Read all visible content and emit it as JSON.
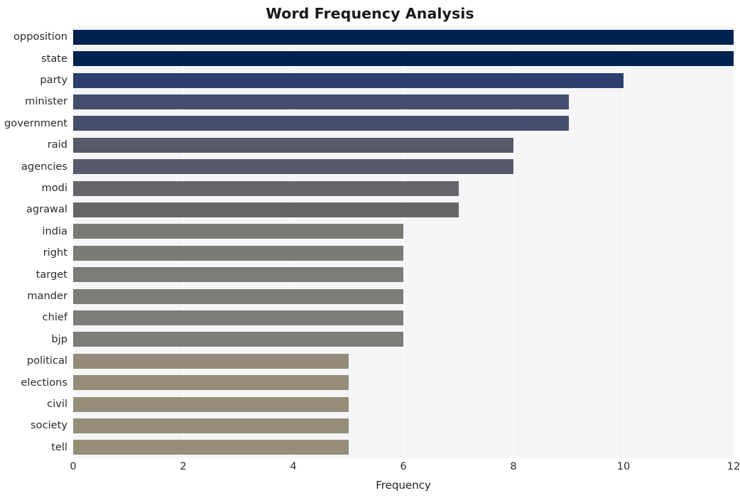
{
  "chart_data": {
    "type": "bar",
    "orientation": "horizontal",
    "title": "Word Frequency Analysis",
    "xlabel": "Frequency",
    "ylabel": "",
    "xlim": [
      0,
      12
    ],
    "ylim": [
      0,
      20
    ],
    "xticks": [
      0,
      2,
      4,
      6,
      8,
      10,
      12
    ],
    "xtick_labels": [
      "0",
      "2",
      "4",
      "6",
      "8",
      "10",
      "12"
    ],
    "grid": true,
    "grid_axis": "x",
    "grid_color": "#ffffff",
    "plot_background": "#f5f5f7",
    "figure_background": "#ffffff",
    "legend": null,
    "categories": [
      "opposition",
      "state",
      "party",
      "minister",
      "government",
      "raid",
      "agencies",
      "modi",
      "agrawal",
      "india",
      "right",
      "target",
      "mander",
      "chief",
      "bjp",
      "political",
      "elections",
      "civil",
      "society",
      "tell"
    ],
    "values": [
      12,
      12,
      10,
      9,
      9,
      8,
      8,
      7,
      7,
      6,
      6,
      6,
      6,
      6,
      6,
      5,
      5,
      5,
      5,
      5
    ],
    "bar_colors": [
      "#00234f",
      "#00234f",
      "#2c3f6e",
      "#434d6d",
      "#454e6c",
      "#565a69",
      "#565a6a",
      "#656669",
      "#666669",
      "#7a7974",
      "#7b7a75",
      "#7c7b77",
      "#7c7b77",
      "#7d7c78",
      "#7d7c78",
      "#948c79",
      "#958d78",
      "#968e78",
      "#968e78",
      "#968d77"
    ],
    "colormap": "cividis-reversed",
    "bars": [
      {
        "label": "opposition",
        "value": 12,
        "color": "#00234f"
      },
      {
        "label": "state",
        "value": 12,
        "color": "#00234f"
      },
      {
        "label": "party",
        "value": 10,
        "color": "#2c3f6e"
      },
      {
        "label": "minister",
        "value": 9,
        "color": "#434d6d"
      },
      {
        "label": "government",
        "value": 9,
        "color": "#454e6c"
      },
      {
        "label": "raid",
        "value": 8,
        "color": "#565a69"
      },
      {
        "label": "agencies",
        "value": 8,
        "color": "#565a6a"
      },
      {
        "label": "modi",
        "value": 7,
        "color": "#656669"
      },
      {
        "label": "agrawal",
        "value": 7,
        "color": "#666669"
      },
      {
        "label": "india",
        "value": 6,
        "color": "#7a7974"
      },
      {
        "label": "right",
        "value": 6,
        "color": "#7b7a75"
      },
      {
        "label": "target",
        "value": 6,
        "color": "#7c7b77"
      },
      {
        "label": "mander",
        "value": 6,
        "color": "#7c7b77"
      },
      {
        "label": "chief",
        "value": 6,
        "color": "#7d7c78"
      },
      {
        "label": "bjp",
        "value": 6,
        "color": "#7d7c78"
      },
      {
        "label": "political",
        "value": 5,
        "color": "#948c79"
      },
      {
        "label": "elections",
        "value": 5,
        "color": "#958d78"
      },
      {
        "label": "civil",
        "value": 5,
        "color": "#968e78"
      },
      {
        "label": "society",
        "value": 5,
        "color": "#968e78"
      },
      {
        "label": "tell",
        "value": 5,
        "color": "#968d77"
      }
    ]
  }
}
